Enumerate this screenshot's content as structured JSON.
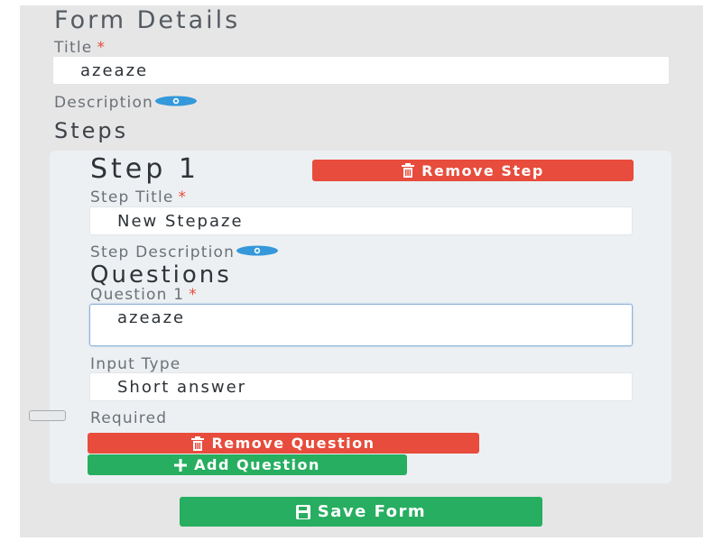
{
  "form": {
    "heading": "Form Details",
    "title_label": "Title",
    "required_marker": "*",
    "title_value": "azeaze",
    "description_label": "Description"
  },
  "steps": {
    "heading": "Steps",
    "step1": {
      "heading": "Step 1",
      "remove_step_label": "Remove Step",
      "step_title_label": "Step Title",
      "step_title_value": "New Stepaze",
      "step_description_label": "Step Description",
      "questions_heading": "Questions",
      "question1": {
        "label": "Question 1",
        "value": "azeaze",
        "input_type_label": "Input Type",
        "input_type_value": "Short answer",
        "required_label": "Required",
        "required_checked": false,
        "remove_question_label": "Remove Question"
      },
      "add_question_label": "Add Question"
    }
  },
  "save_form_label": "Save Form",
  "colors": {
    "danger": "#e74c3c",
    "success": "#27ae60",
    "eye_icon": "#3498db"
  },
  "icons": {
    "description_toggle": "eye-icon",
    "remove": "trash-icon",
    "add": "plus-icon",
    "save": "save-icon"
  }
}
